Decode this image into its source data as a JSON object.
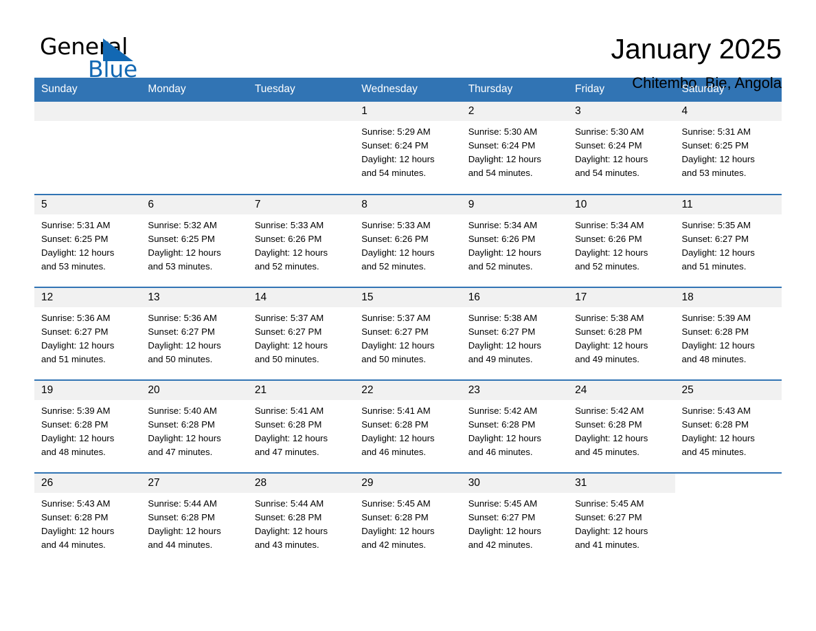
{
  "brand": {
    "name_part1": "General",
    "name_part2": "Blue",
    "accent_color": "#1268b3"
  },
  "header": {
    "title": "January 2025",
    "subtitle": "Chitembo, Bie, Angola"
  },
  "theme": {
    "header_row_bg": "#3174b4",
    "daynum_bg": "#f1f1f1",
    "page_bg": "#ffffff",
    "text_color": "#000000"
  },
  "weekday_headers": [
    "Sunday",
    "Monday",
    "Tuesday",
    "Wednesday",
    "Thursday",
    "Friday",
    "Saturday"
  ],
  "weeks": [
    [
      {
        "day": "",
        "blank": true
      },
      {
        "day": "",
        "blank": true
      },
      {
        "day": "",
        "blank": true
      },
      {
        "day": "1",
        "sunrise": "Sunrise: 5:29 AM",
        "sunset": "Sunset: 6:24 PM",
        "daylight_line1": "Daylight: 12 hours",
        "daylight_line2": "and 54 minutes."
      },
      {
        "day": "2",
        "sunrise": "Sunrise: 5:30 AM",
        "sunset": "Sunset: 6:24 PM",
        "daylight_line1": "Daylight: 12 hours",
        "daylight_line2": "and 54 minutes."
      },
      {
        "day": "3",
        "sunrise": "Sunrise: 5:30 AM",
        "sunset": "Sunset: 6:24 PM",
        "daylight_line1": "Daylight: 12 hours",
        "daylight_line2": "and 54 minutes."
      },
      {
        "day": "4",
        "sunrise": "Sunrise: 5:31 AM",
        "sunset": "Sunset: 6:25 PM",
        "daylight_line1": "Daylight: 12 hours",
        "daylight_line2": "and 53 minutes."
      }
    ],
    [
      {
        "day": "5",
        "sunrise": "Sunrise: 5:31 AM",
        "sunset": "Sunset: 6:25 PM",
        "daylight_line1": "Daylight: 12 hours",
        "daylight_line2": "and 53 minutes."
      },
      {
        "day": "6",
        "sunrise": "Sunrise: 5:32 AM",
        "sunset": "Sunset: 6:25 PM",
        "daylight_line1": "Daylight: 12 hours",
        "daylight_line2": "and 53 minutes."
      },
      {
        "day": "7",
        "sunrise": "Sunrise: 5:33 AM",
        "sunset": "Sunset: 6:26 PM",
        "daylight_line1": "Daylight: 12 hours",
        "daylight_line2": "and 52 minutes."
      },
      {
        "day": "8",
        "sunrise": "Sunrise: 5:33 AM",
        "sunset": "Sunset: 6:26 PM",
        "daylight_line1": "Daylight: 12 hours",
        "daylight_line2": "and 52 minutes."
      },
      {
        "day": "9",
        "sunrise": "Sunrise: 5:34 AM",
        "sunset": "Sunset: 6:26 PM",
        "daylight_line1": "Daylight: 12 hours",
        "daylight_line2": "and 52 minutes."
      },
      {
        "day": "10",
        "sunrise": "Sunrise: 5:34 AM",
        "sunset": "Sunset: 6:26 PM",
        "daylight_line1": "Daylight: 12 hours",
        "daylight_line2": "and 52 minutes."
      },
      {
        "day": "11",
        "sunrise": "Sunrise: 5:35 AM",
        "sunset": "Sunset: 6:27 PM",
        "daylight_line1": "Daylight: 12 hours",
        "daylight_line2": "and 51 minutes."
      }
    ],
    [
      {
        "day": "12",
        "sunrise": "Sunrise: 5:36 AM",
        "sunset": "Sunset: 6:27 PM",
        "daylight_line1": "Daylight: 12 hours",
        "daylight_line2": "and 51 minutes."
      },
      {
        "day": "13",
        "sunrise": "Sunrise: 5:36 AM",
        "sunset": "Sunset: 6:27 PM",
        "daylight_line1": "Daylight: 12 hours",
        "daylight_line2": "and 50 minutes."
      },
      {
        "day": "14",
        "sunrise": "Sunrise: 5:37 AM",
        "sunset": "Sunset: 6:27 PM",
        "daylight_line1": "Daylight: 12 hours",
        "daylight_line2": "and 50 minutes."
      },
      {
        "day": "15",
        "sunrise": "Sunrise: 5:37 AM",
        "sunset": "Sunset: 6:27 PM",
        "daylight_line1": "Daylight: 12 hours",
        "daylight_line2": "and 50 minutes."
      },
      {
        "day": "16",
        "sunrise": "Sunrise: 5:38 AM",
        "sunset": "Sunset: 6:27 PM",
        "daylight_line1": "Daylight: 12 hours",
        "daylight_line2": "and 49 minutes."
      },
      {
        "day": "17",
        "sunrise": "Sunrise: 5:38 AM",
        "sunset": "Sunset: 6:28 PM",
        "daylight_line1": "Daylight: 12 hours",
        "daylight_line2": "and 49 minutes."
      },
      {
        "day": "18",
        "sunrise": "Sunrise: 5:39 AM",
        "sunset": "Sunset: 6:28 PM",
        "daylight_line1": "Daylight: 12 hours",
        "daylight_line2": "and 48 minutes."
      }
    ],
    [
      {
        "day": "19",
        "sunrise": "Sunrise: 5:39 AM",
        "sunset": "Sunset: 6:28 PM",
        "daylight_line1": "Daylight: 12 hours",
        "daylight_line2": "and 48 minutes."
      },
      {
        "day": "20",
        "sunrise": "Sunrise: 5:40 AM",
        "sunset": "Sunset: 6:28 PM",
        "daylight_line1": "Daylight: 12 hours",
        "daylight_line2": "and 47 minutes."
      },
      {
        "day": "21",
        "sunrise": "Sunrise: 5:41 AM",
        "sunset": "Sunset: 6:28 PM",
        "daylight_line1": "Daylight: 12 hours",
        "daylight_line2": "and 47 minutes."
      },
      {
        "day": "22",
        "sunrise": "Sunrise: 5:41 AM",
        "sunset": "Sunset: 6:28 PM",
        "daylight_line1": "Daylight: 12 hours",
        "daylight_line2": "and 46 minutes."
      },
      {
        "day": "23",
        "sunrise": "Sunrise: 5:42 AM",
        "sunset": "Sunset: 6:28 PM",
        "daylight_line1": "Daylight: 12 hours",
        "daylight_line2": "and 46 minutes."
      },
      {
        "day": "24",
        "sunrise": "Sunrise: 5:42 AM",
        "sunset": "Sunset: 6:28 PM",
        "daylight_line1": "Daylight: 12 hours",
        "daylight_line2": "and 45 minutes."
      },
      {
        "day": "25",
        "sunrise": "Sunrise: 5:43 AM",
        "sunset": "Sunset: 6:28 PM",
        "daylight_line1": "Daylight: 12 hours",
        "daylight_line2": "and 45 minutes."
      }
    ],
    [
      {
        "day": "26",
        "sunrise": "Sunrise: 5:43 AM",
        "sunset": "Sunset: 6:28 PM",
        "daylight_line1": "Daylight: 12 hours",
        "daylight_line2": "and 44 minutes."
      },
      {
        "day": "27",
        "sunrise": "Sunrise: 5:44 AM",
        "sunset": "Sunset: 6:28 PM",
        "daylight_line1": "Daylight: 12 hours",
        "daylight_line2": "and 44 minutes."
      },
      {
        "day": "28",
        "sunrise": "Sunrise: 5:44 AM",
        "sunset": "Sunset: 6:28 PM",
        "daylight_line1": "Daylight: 12 hours",
        "daylight_line2": "and 43 minutes."
      },
      {
        "day": "29",
        "sunrise": "Sunrise: 5:45 AM",
        "sunset": "Sunset: 6:28 PM",
        "daylight_line1": "Daylight: 12 hours",
        "daylight_line2": "and 42 minutes."
      },
      {
        "day": "30",
        "sunrise": "Sunrise: 5:45 AM",
        "sunset": "Sunset: 6:27 PM",
        "daylight_line1": "Daylight: 12 hours",
        "daylight_line2": "and 42 minutes."
      },
      {
        "day": "31",
        "sunrise": "Sunrise: 5:45 AM",
        "sunset": "Sunset: 6:27 PM",
        "daylight_line1": "Daylight: 12 hours",
        "daylight_line2": "and 41 minutes."
      },
      {
        "day": "",
        "blank": true,
        "trailing": true
      }
    ]
  ]
}
